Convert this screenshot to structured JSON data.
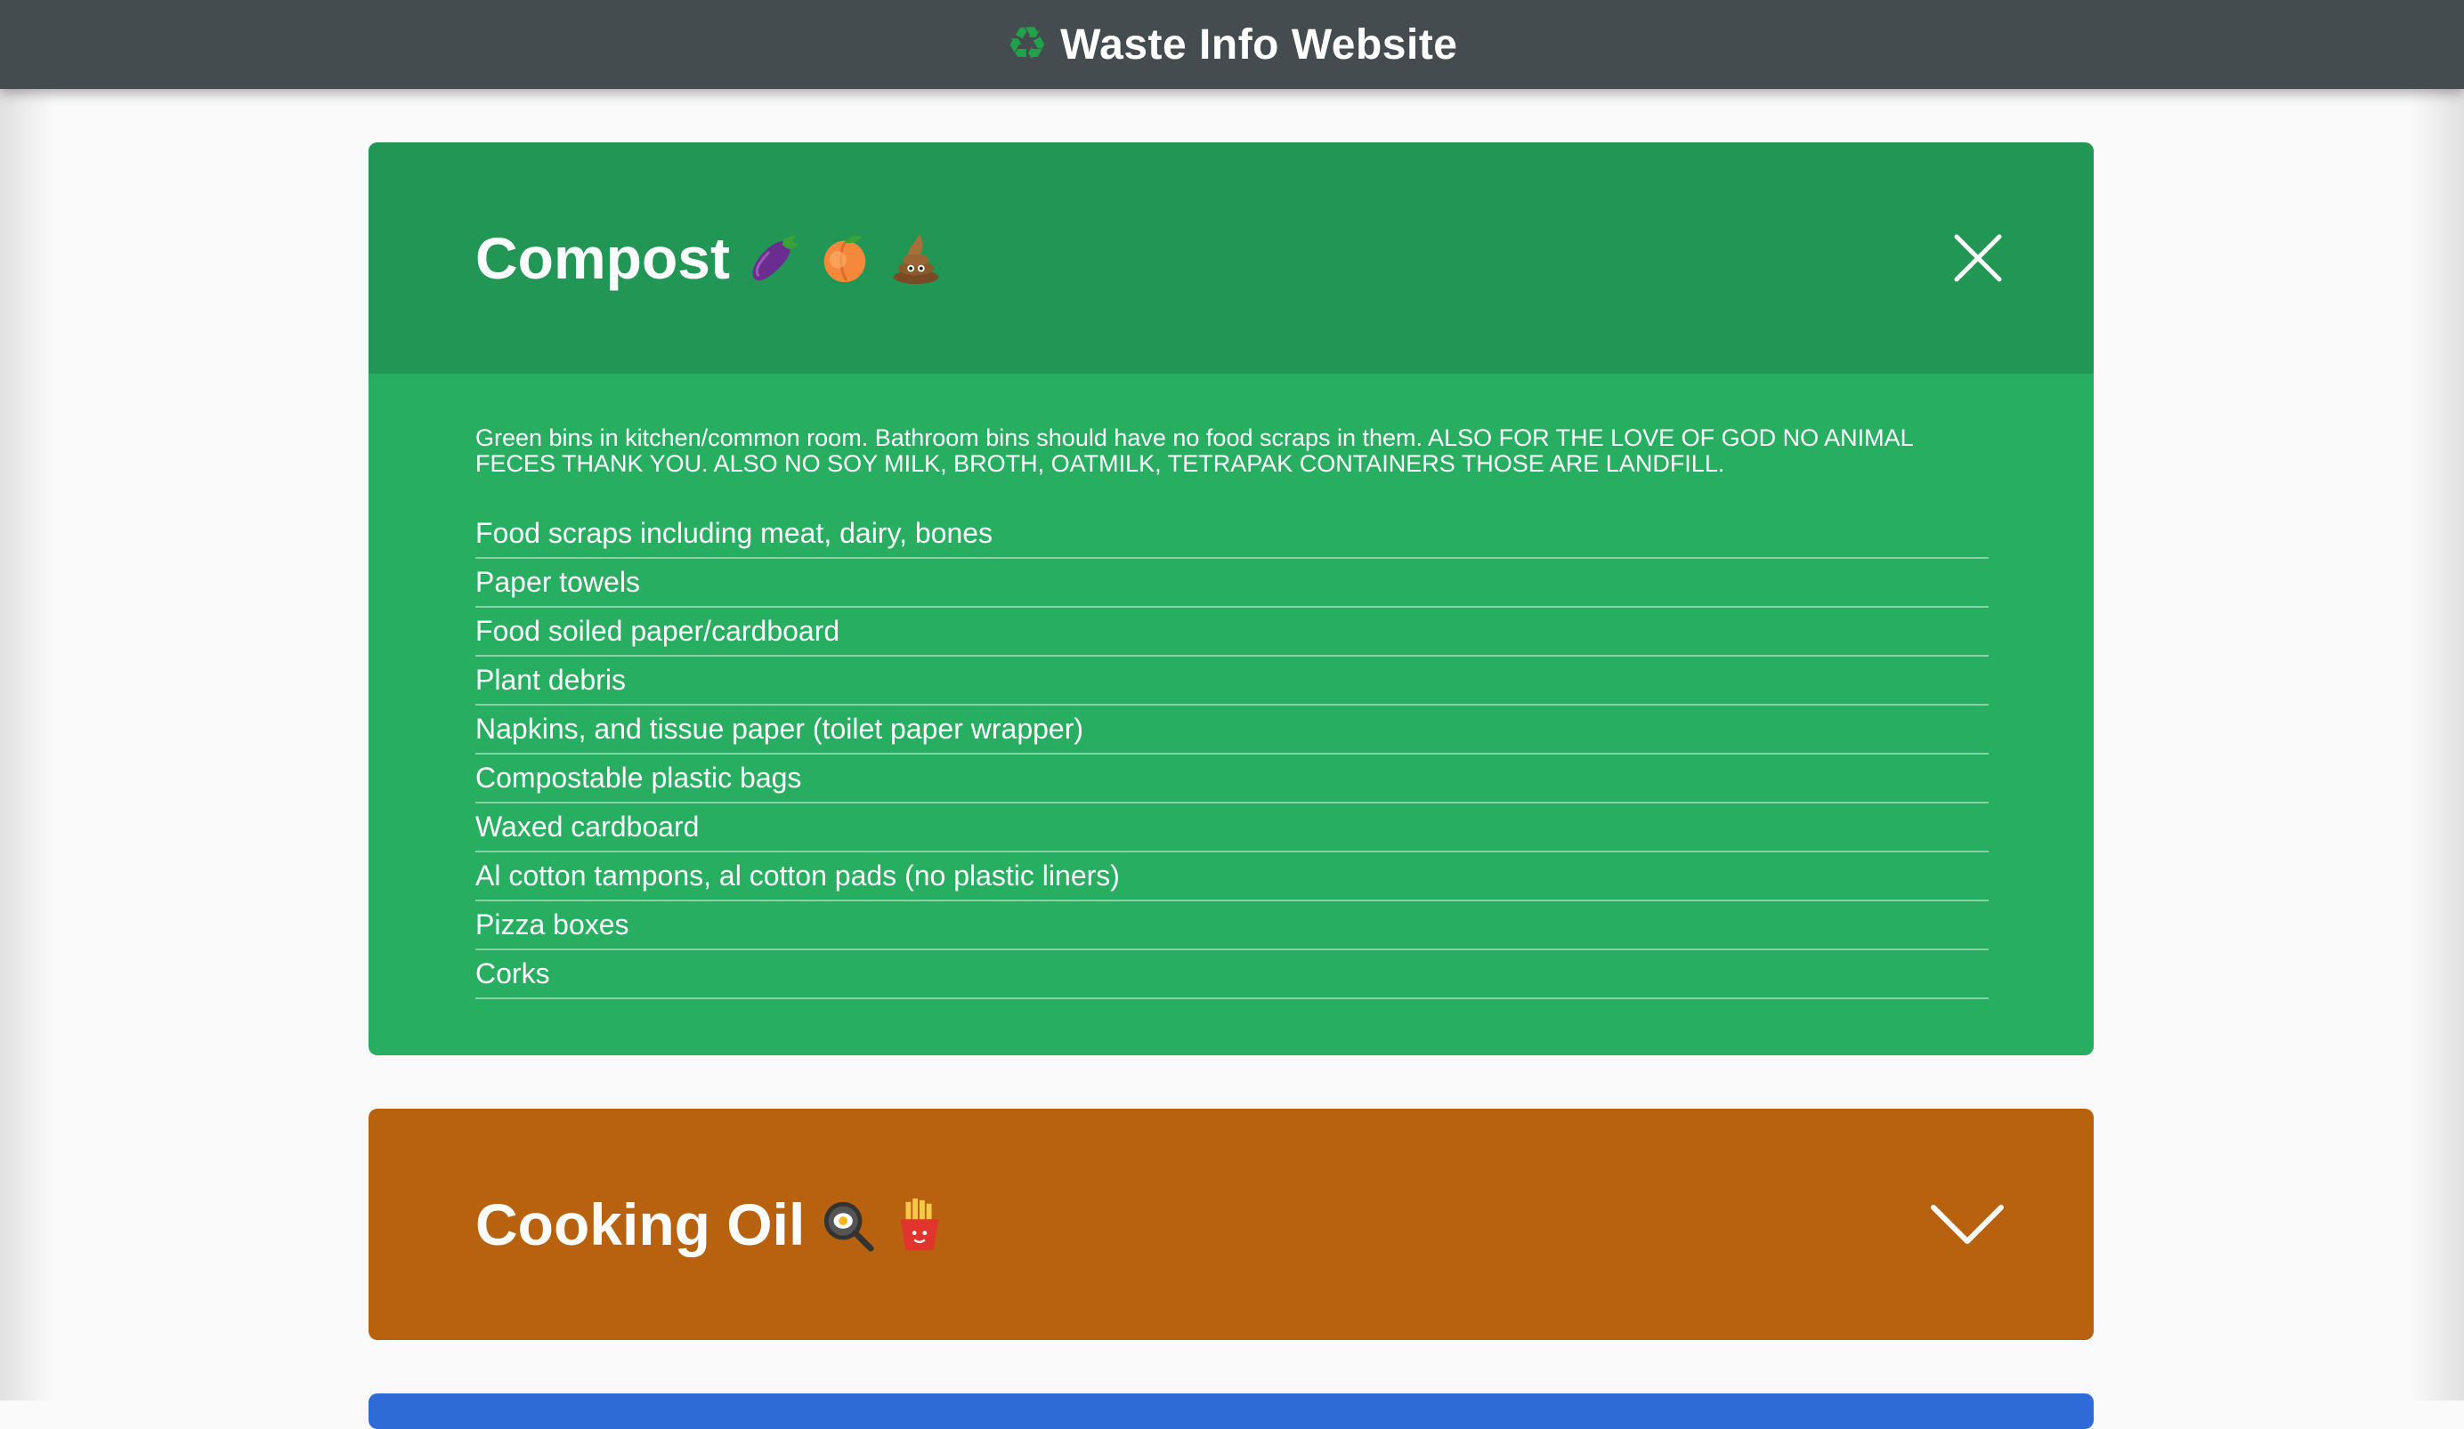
{
  "header": {
    "icon": "recycle-icon",
    "title": "Waste Info Website"
  },
  "sections": [
    {
      "id": "compost",
      "title": "Compost",
      "emojis": [
        "eggplant-icon",
        "peach-icon",
        "poop-icon"
      ],
      "expanded": true,
      "toggle_icon": "close-icon",
      "color": "#27ae60",
      "header_color": "#229654",
      "note": "Green bins in kitchen/common room. Bathroom bins should have no food scraps in them. ALSO FOR THE LOVE OF GOD NO ANIMAL FECES THANK YOU. ALSO NO SOY MILK, BROTH, OATMILK, TETRAPAK CONTAINERS THOSE ARE LANDFILL.",
      "items": [
        "Food scraps including meat, dairy, bones",
        "Paper towels",
        "Food soiled paper/cardboard",
        "Plant debris",
        "Napkins, and tissue paper (toilet paper wrapper)",
        "Compostable plastic bags",
        "Waxed cardboard",
        "Al cotton tampons, al cotton pads (no plastic liners)",
        "Pizza boxes",
        "Corks"
      ]
    },
    {
      "id": "cooking-oil",
      "title": "Cooking Oil",
      "emojis": [
        "frying-pan-icon",
        "french-fries-icon"
      ],
      "expanded": false,
      "toggle_icon": "chevron-down-icon",
      "color": "#b8610f"
    },
    {
      "id": "next",
      "color": "#2f6bd6",
      "expanded": false
    }
  ]
}
